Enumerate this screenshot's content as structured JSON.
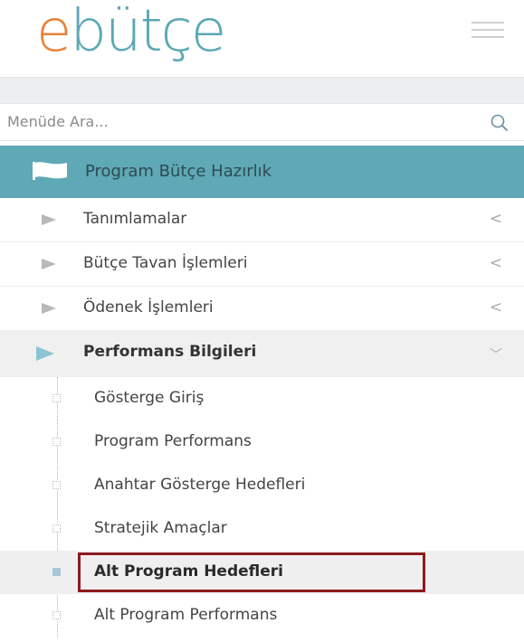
{
  "brand": {
    "logo_e": "e",
    "logo_rest": "bütçe"
  },
  "search": {
    "placeholder": "Menüde Ara..."
  },
  "section": {
    "label": "Program Bütçe Hazırlık"
  },
  "menu": [
    {
      "label": "Tanımlamalar",
      "arrow": "<"
    },
    {
      "label": "Bütçe Tavan İşlemleri",
      "arrow": "<"
    },
    {
      "label": "Ödenek İşlemleri",
      "arrow": "<"
    }
  ],
  "open_menu": {
    "label": "Performans Bilgileri",
    "arrow": "﹀",
    "items": [
      {
        "label": "Gösterge Giriş"
      },
      {
        "label": "Program Performans"
      },
      {
        "label": "Anahtar Gösterge Hedefleri"
      },
      {
        "label": "Stratejik Amaçlar"
      },
      {
        "label": "Alt Program Hedefleri",
        "active": true,
        "highlighted": true
      },
      {
        "label": "Alt Program Performans"
      }
    ]
  },
  "colors": {
    "brand_orange": "#e8833a",
    "brand_teal": "#5ba8b5",
    "section_bg": "#5fa8b6",
    "highlight_border": "#8b1a1f"
  },
  "icons": [
    "menu-icon",
    "search-icon",
    "flag-icon",
    "triangle-right-icon",
    "chevron-left-icon",
    "chevron-down-icon",
    "tree-node-icon"
  ]
}
